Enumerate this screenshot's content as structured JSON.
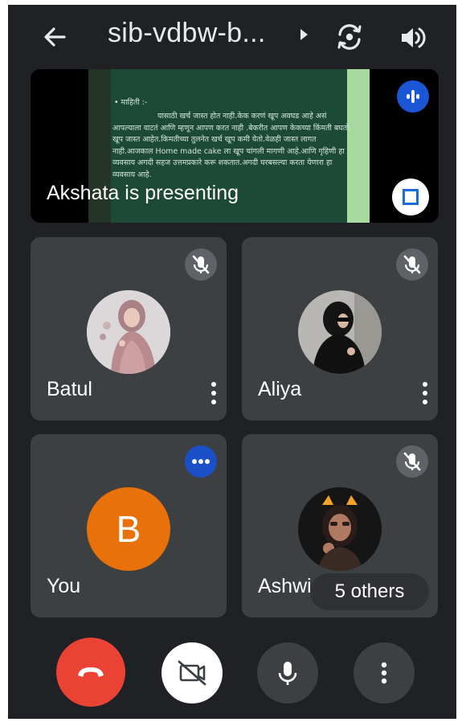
{
  "meeting": {
    "title": "sib-vdbw-b...",
    "back_icon": "arrow-back-icon",
    "switch_camera_icon": "switch-camera-icon",
    "audio_output_icon": "volume-icon"
  },
  "presentation": {
    "label": "Akshata is presenting",
    "slide_heading": "• माहिती :-",
    "slide_text": "यासाठी खर्च जास्त होत नाही.केक करणं खूप अवघड आहे असं आपल्याला वाटतं आणि म्हणून आपण करत नाही .बेकरीत आपण केकच्या किंमती बघतो खूप जास्त आहेत.किमतीच्या तुलनेत खर्च खूप कमी येतो.वेळही जास्त लागत नाही.आजकाल Home made cake ला खूप चांगली मागणी आहे.आणि गृहिणी हा व्यवसाय अगदी सहज उत्तमप्रकारे करू शकतात.अगदी घरबसल्या करता येणारा हा व्यवसाय आहे.",
    "accent": "#1a56d6"
  },
  "participants": [
    {
      "name": "Batul",
      "muted": true
    },
    {
      "name": "Aliya",
      "muted": true
    },
    {
      "name": "You",
      "initial": "B",
      "avatar_color": "#e8710a"
    },
    {
      "name": "Ashwi",
      "muted": true
    }
  ],
  "others_label": "5 others",
  "controls": {
    "end_call_color": "#ea4335",
    "end_call_icon": "call-end-icon",
    "camera_icon": "videocam-off-icon",
    "mic_icon": "mic-icon",
    "more_icon": "more-vert-icon"
  }
}
